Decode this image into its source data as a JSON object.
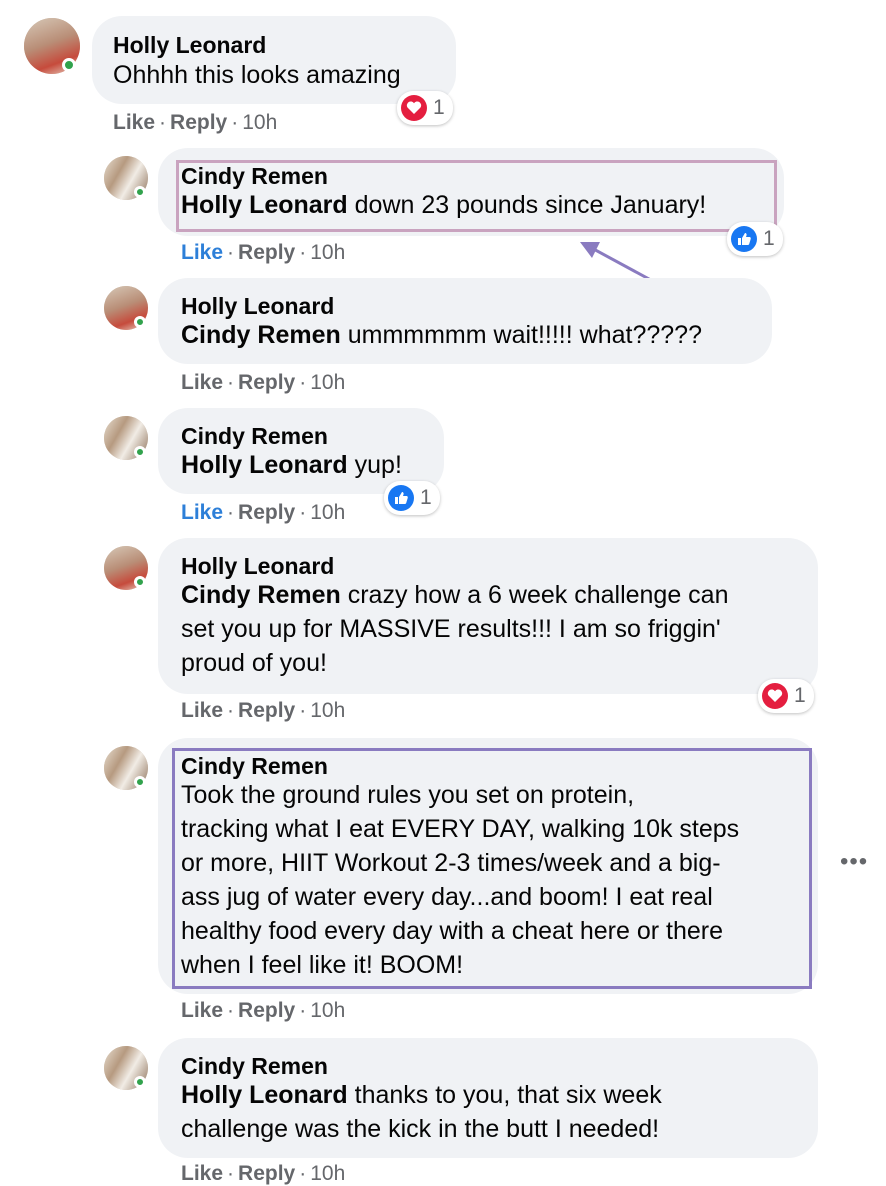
{
  "comments": [
    {
      "author": "Holly Leonard",
      "mention": "",
      "text": "Ohhhh this looks amazing",
      "like": "Like",
      "reply": "Reply",
      "time": "10h",
      "reaction_count": "1",
      "reaction": "love"
    },
    {
      "author": "Cindy Remen",
      "mention": "Holly Leonard",
      "text": " down 23 pounds since January!",
      "like": "Like",
      "reply": "Reply",
      "time": "10h",
      "reaction_count": "1",
      "reaction": "like"
    },
    {
      "author": "Holly Leonard",
      "mention": "Cindy Remen",
      "text": " ummmmmm wait!!!!! what?????",
      "like": "Like",
      "reply": "Reply",
      "time": "10h"
    },
    {
      "author": "Cindy Remen",
      "mention": "Holly Leonard",
      "text": " yup!",
      "like": "Like",
      "reply": "Reply",
      "time": "10h",
      "reaction_count": "1",
      "reaction": "like"
    },
    {
      "author": "Holly Leonard",
      "mention": "Cindy Remen",
      "text": " crazy how a 6 week challenge can\nset you up for MASSIVE results!!! I am so friggin'\nproud of you!",
      "like": "Like",
      "reply": "Reply",
      "time": "10h",
      "reaction_count": "1",
      "reaction": "love"
    },
    {
      "author": "Cindy Remen",
      "mention": "",
      "text": "Took the ground rules you set on protein,\ntracking what I eat EVERY DAY, walking 10k steps\nor more, HIIT Workout 2-3 times/week and a big-\nass jug of water every day...and boom! I eat real\nhealthy food every day with a cheat here or there\nwhen I feel like it! BOOM!",
      "like": "Like",
      "reply": "Reply",
      "time": "10h"
    },
    {
      "author": "Cindy Remen",
      "mention": "Holly Leonard",
      "text": " thanks to you, that six week\nchallenge was the kick in the butt I needed!",
      "like": "Like",
      "reply": "Reply",
      "time": "10h"
    }
  ],
  "more_icon": "more-options-icon",
  "colors": {
    "online": "#31a24c",
    "like_blue": "#2d7fd8",
    "love_red": "#e41e3f",
    "highlight_pink": "#c9a3bf",
    "highlight_purple": "#8a7bc0"
  }
}
